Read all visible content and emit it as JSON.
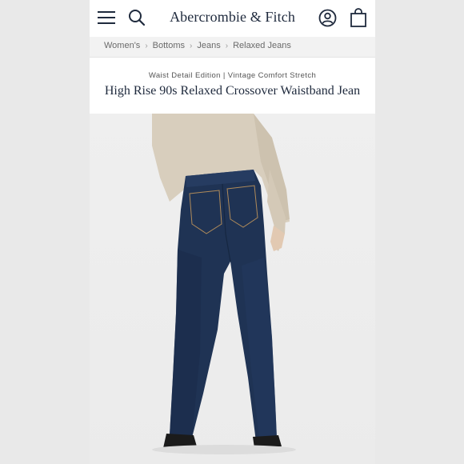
{
  "header": {
    "brand": "Abercrombie & Fitch",
    "menu_icon": "hamburger-menu-icon",
    "search_icon": "search-icon",
    "account_icon": "account-icon",
    "bag_icon": "shopping-bag-icon"
  },
  "breadcrumb": {
    "items": [
      "Women's",
      "Bottoms",
      "Jeans",
      "Relaxed Jeans"
    ],
    "separator_icon": "chevron-right-icon"
  },
  "product": {
    "subtitle": "Waist Detail Edition | Vintage Comfort Stretch",
    "title": "High Rise 90s Relaxed Crossover Waistband Jean"
  },
  "colors": {
    "brand_text": "#1f2a3d",
    "denim": "#1f3354",
    "shirt": "#d9cfbf",
    "background": "#ececec"
  }
}
